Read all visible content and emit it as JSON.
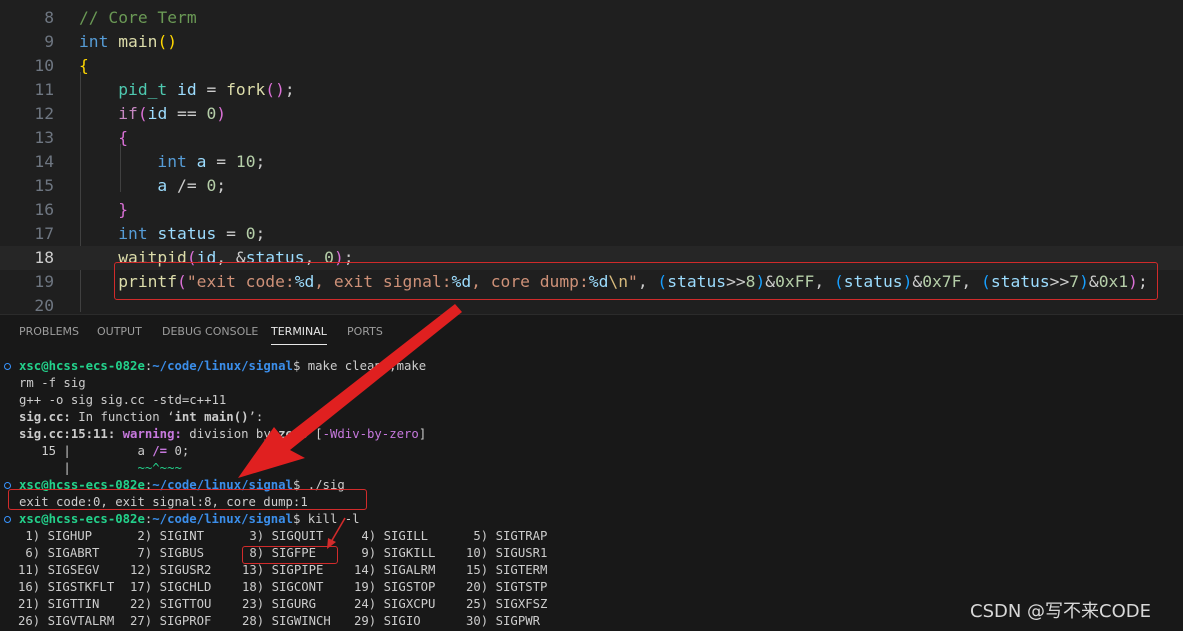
{
  "editor": {
    "lines": [
      {
        "n": "8",
        "active": false,
        "t": [
          [
            "cm",
            "// Core Term"
          ]
        ]
      },
      {
        "n": "9",
        "active": false,
        "t": [
          [
            "kw",
            "int"
          ],
          [
            "pu",
            " "
          ],
          [
            "fn",
            "main"
          ],
          [
            "b1",
            "()"
          ]
        ]
      },
      {
        "n": "10",
        "active": false,
        "t": [
          [
            "b1",
            "{"
          ]
        ]
      },
      {
        "n": "11",
        "active": false,
        "t": [
          [
            "pu",
            "    "
          ],
          [
            "ty",
            "pid_t"
          ],
          [
            "pu",
            " "
          ],
          [
            "vr",
            "id"
          ],
          [
            "pu",
            " = "
          ],
          [
            "fn",
            "fork"
          ],
          [
            "b2",
            "()"
          ],
          [
            "pu",
            ";"
          ]
        ]
      },
      {
        "n": "12",
        "active": false,
        "t": [
          [
            "pu",
            "    "
          ],
          [
            "ct",
            "if"
          ],
          [
            "b2",
            "("
          ],
          [
            "vr",
            "id"
          ],
          [
            "pu",
            " == "
          ],
          [
            "nm",
            "0"
          ],
          [
            "b2",
            ")"
          ]
        ]
      },
      {
        "n": "13",
        "active": false,
        "t": [
          [
            "pu",
            "    "
          ],
          [
            "b2",
            "{"
          ]
        ]
      },
      {
        "n": "14",
        "active": false,
        "t": [
          [
            "pu",
            "        "
          ],
          [
            "kw",
            "int"
          ],
          [
            "pu",
            " "
          ],
          [
            "vr",
            "a"
          ],
          [
            "pu",
            " = "
          ],
          [
            "nm",
            "10"
          ],
          [
            "pu",
            ";"
          ]
        ]
      },
      {
        "n": "15",
        "active": false,
        "t": [
          [
            "pu",
            "        "
          ],
          [
            "vr",
            "a"
          ],
          [
            "pu",
            " /= "
          ],
          [
            "nm",
            "0"
          ],
          [
            "pu",
            ";"
          ]
        ]
      },
      {
        "n": "16",
        "active": false,
        "t": [
          [
            "pu",
            "    "
          ],
          [
            "b2",
            "}"
          ]
        ]
      },
      {
        "n": "17",
        "active": false,
        "t": [
          [
            "pu",
            "    "
          ],
          [
            "kw",
            "int"
          ],
          [
            "pu",
            " "
          ],
          [
            "vr",
            "status"
          ],
          [
            "pu",
            " = "
          ],
          [
            "nm",
            "0"
          ],
          [
            "pu",
            ";"
          ]
        ]
      },
      {
        "n": "18",
        "active": true,
        "t": [
          [
            "pu",
            "    "
          ],
          [
            "fn",
            "waitpid"
          ],
          [
            "b2",
            "("
          ],
          [
            "vr",
            "id"
          ],
          [
            "pu",
            ", &"
          ],
          [
            "vr",
            "status"
          ],
          [
            "pu",
            ", "
          ],
          [
            "nm",
            "0"
          ],
          [
            "b2",
            ")"
          ],
          [
            "pu",
            ";"
          ]
        ]
      },
      {
        "n": "19",
        "active": false,
        "t": [
          [
            "pu",
            "    "
          ],
          [
            "fn",
            "printf"
          ],
          [
            "b2",
            "("
          ],
          [
            "st",
            "\"exit code:"
          ],
          [
            "fm",
            "%d"
          ],
          [
            "st",
            ", exit signal:"
          ],
          [
            "fm",
            "%d"
          ],
          [
            "st",
            ", core dump:"
          ],
          [
            "fm",
            "%d"
          ],
          [
            "es",
            "\\n"
          ],
          [
            "st",
            "\""
          ],
          [
            "pu",
            ", "
          ],
          [
            "b3",
            "("
          ],
          [
            "vr",
            "status"
          ],
          [
            "pu",
            ">>"
          ],
          [
            "nm",
            "8"
          ],
          [
            "b3",
            ")"
          ],
          [
            "pu",
            "&"
          ],
          [
            "nm",
            "0xFF"
          ],
          [
            "pu",
            ", "
          ],
          [
            "b3",
            "("
          ],
          [
            "vr",
            "status"
          ],
          [
            "b3",
            ")"
          ],
          [
            "pu",
            "&"
          ],
          [
            "nm",
            "0x7F"
          ],
          [
            "pu",
            ", "
          ],
          [
            "b3",
            "("
          ],
          [
            "vr",
            "status"
          ],
          [
            "pu",
            ">>"
          ],
          [
            "nm",
            "7"
          ],
          [
            "b3",
            ")"
          ],
          [
            "pu",
            "&"
          ],
          [
            "nm",
            "0x1"
          ],
          [
            "b2",
            ")"
          ],
          [
            "pu",
            ";"
          ]
        ]
      },
      {
        "n": "20",
        "active": false,
        "t": []
      }
    ]
  },
  "panel": {
    "tabs": [
      {
        "label": "PROBLEMS",
        "active": false
      },
      {
        "label": "OUTPUT",
        "active": false
      },
      {
        "label": "DEBUG CONSOLE",
        "active": false
      },
      {
        "label": "TERMINAL",
        "active": true
      },
      {
        "label": "PORTS",
        "active": false
      }
    ]
  },
  "terminal": {
    "lines": [
      {
        "prompt": true,
        "t": [
          [
            "user",
            "xsc@hcss-ecs-082e"
          ],
          [
            "pu",
            ":"
          ],
          [
            "path",
            "~/code/linux/signal"
          ],
          [
            "pu",
            "$ make clean ;make"
          ]
        ]
      },
      {
        "prompt": false,
        "t": [
          [
            "pu",
            "rm -f sig"
          ]
        ]
      },
      {
        "prompt": false,
        "t": [
          [
            "pu",
            "g++ -o sig sig.cc -std=c++11"
          ]
        ]
      },
      {
        "prompt": false,
        "t": [
          [
            "bold",
            "sig.cc:"
          ],
          [
            "pu",
            " In function ‘"
          ],
          [
            "bold",
            "int main()"
          ],
          [
            "pu",
            "’:"
          ]
        ]
      },
      {
        "prompt": false,
        "t": [
          [
            "bold",
            "sig.cc:15:11:"
          ],
          [
            "pu",
            " "
          ],
          [
            "warn",
            "warning:"
          ],
          [
            "pu",
            " division by "
          ],
          [
            "bold",
            "zero"
          ],
          [
            "pu",
            " ["
          ],
          [
            "warnflag",
            "-Wdiv-by-zero"
          ],
          [
            "pu",
            "]"
          ]
        ]
      },
      {
        "prompt": false,
        "t": [
          [
            "pu",
            "   15 |         a "
          ],
          [
            "warn",
            "/="
          ],
          [
            "pu",
            " 0;"
          ]
        ]
      },
      {
        "prompt": false,
        "t": [
          [
            "pu",
            "      |         "
          ],
          [
            "tilde",
            "~~^~~~"
          ]
        ]
      },
      {
        "prompt": true,
        "t": [
          [
            "user",
            "xsc@hcss-ecs-082e"
          ],
          [
            "pu",
            ":"
          ],
          [
            "path",
            "~/code/linux/signal"
          ],
          [
            "pu",
            "$ ./sig"
          ]
        ]
      },
      {
        "prompt": false,
        "t": [
          [
            "pu",
            "exit code:0, exit signal:8, core dump:1"
          ]
        ]
      },
      {
        "prompt": true,
        "t": [
          [
            "user",
            "xsc@hcss-ecs-082e"
          ],
          [
            "pu",
            ":"
          ],
          [
            "path",
            "~/code/linux/signal"
          ],
          [
            "pu",
            "$ kill -l"
          ]
        ]
      }
    ],
    "signals": [
      [
        " 1) SIGHUP",
        " 2) SIGINT",
        " 3) SIGQUIT",
        " 4) SIGILL",
        " 5) SIGTRAP"
      ],
      [
        " 6) SIGABRT",
        " 7) SIGBUS",
        " 8) SIGFPE",
        " 9) SIGKILL",
        "10) SIGUSR1"
      ],
      [
        "11) SIGSEGV",
        "12) SIGUSR2",
        "13) SIGPIPE",
        "14) SIGALRM",
        "15) SIGTERM"
      ],
      [
        "16) SIGSTKFLT",
        "17) SIGCHLD",
        "18) SIGCONT",
        "19) SIGSTOP",
        "20) SIGTSTP"
      ],
      [
        "21) SIGTTIN",
        "22) SIGTTOU",
        "23) SIGURG",
        "24) SIGXCPU",
        "25) SIGXFSZ"
      ],
      [
        "26) SIGVTALRM",
        "27) SIGPROF",
        "28) SIGWINCH",
        "29) SIGIO",
        "30) SIGPWR"
      ]
    ]
  },
  "watermark": "CSDN @写不来CODE",
  "colors": {
    "annotation": "#d12b2b",
    "accent": "#3794ff"
  }
}
